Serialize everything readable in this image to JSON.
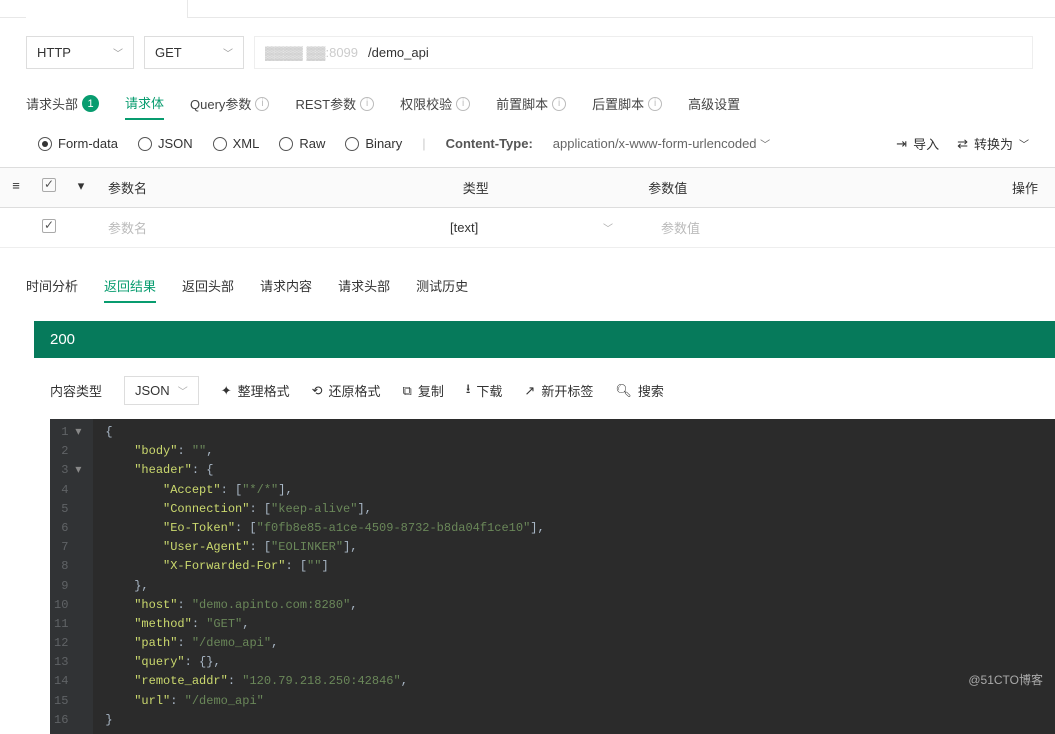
{
  "protocol": "HTTP",
  "method": "GET",
  "url_prefix": "▓▓▓▓  ▓▓:8099",
  "url_path": "/demo_api",
  "tabs": {
    "headers": "请求头部",
    "headers_count": "1",
    "body": "请求体",
    "query": "Query参数",
    "rest": "REST参数",
    "auth": "权限校验",
    "prescript": "前置脚本",
    "postscript": "后置脚本",
    "advanced": "高级设置"
  },
  "body_types": {
    "form": "Form-data",
    "json": "JSON",
    "xml": "XML",
    "raw": "Raw",
    "binary": "Binary"
  },
  "content_type_label": "Content-Type:",
  "content_type_value": "application/x-www-form-urlencoded",
  "import_label": "导入",
  "export_label": "转换为",
  "table_head": {
    "name": "参数名",
    "type": "类型",
    "value": "参数值",
    "op": "操作"
  },
  "table_placeholder": {
    "name": "参数名",
    "type": "[text]",
    "value": "参数值"
  },
  "result_tabs": {
    "timing": "时间分析",
    "result": "返回结果",
    "resp_headers": "返回头部",
    "req_body": "请求内容",
    "req_headers": "请求头部",
    "history": "测试历史"
  },
  "status_code": "200",
  "resp_toolbar": {
    "content_type_label": "内容类型",
    "content_type_value": "JSON",
    "format": "整理格式",
    "restore": "还原格式",
    "copy": "复制",
    "download": "下载",
    "newtab": "新开标签",
    "search": "搜索"
  },
  "json_body": {
    "body": "",
    "header": {
      "Accept": [
        "*/*"
      ],
      "Connection": [
        "keep-alive"
      ],
      "Eo-Token": [
        "f0fb8e85-a1ce-4509-8732-b8da04f1ce10"
      ],
      "User-Agent": [
        "EOLINKER"
      ],
      "X-Forwarded-For": [
        ""
      ]
    },
    "host": "demo.apinto.com:8280",
    "method": "GET",
    "path": "/demo_api",
    "query": {},
    "remote_addr": "120.79.218.250:42846",
    "url": "/demo_api"
  },
  "line_count": 16,
  "watermark": "@51CTO博客"
}
